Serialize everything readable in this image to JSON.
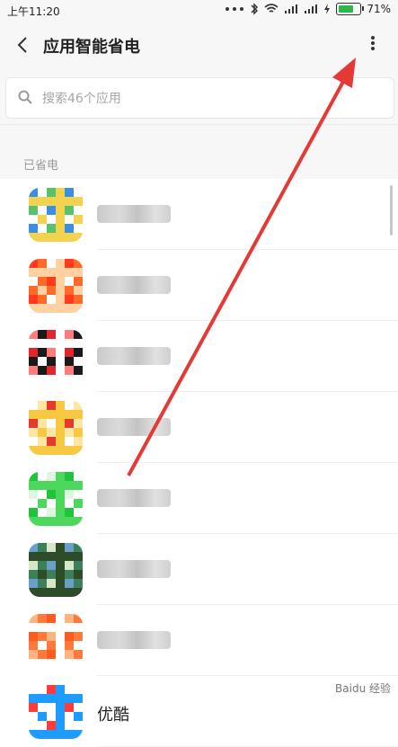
{
  "status": {
    "time": "上午11:20",
    "battery": "71%",
    "battery_level": 0.71
  },
  "appbar": {
    "title": "应用智能省电"
  },
  "search": {
    "placeholder": "搜索46个应用"
  },
  "section": {
    "label": "已省电"
  },
  "apps": [
    {
      "icon_colors": [
        "#3a8fe0",
        "#f2d24e",
        "#58c26a",
        "#ffffff"
      ]
    },
    {
      "icon_colors": [
        "#ff6a2b",
        "#ff3b1b",
        "#ffd0a0",
        "#ffffff"
      ]
    },
    {
      "icon_colors": [
        "#e3262c",
        "#1a1a1a",
        "#ff7c7c",
        "#ffffff"
      ]
    },
    {
      "icon_colors": [
        "#f7c842",
        "#e43a2b",
        "#ffe7a3",
        "#ffffff"
      ]
    },
    {
      "icon_colors": [
        "#1fc43c",
        "#4cd85c",
        "#dff6e1",
        "#ffffff"
      ]
    },
    {
      "icon_colors": [
        "#3c7f5a",
        "#6aa0c8",
        "#2e4c2a",
        "#d8e6c8"
      ]
    },
    {
      "icon_colors": [
        "#ff5a1f",
        "#ff7a3a",
        "#ffb47f",
        "#ffffff"
      ]
    },
    {
      "name": "优酷",
      "icon_colors": [
        "#1e9bff",
        "#ff3b3b",
        "#ffffff",
        "#ffffff"
      ]
    }
  ],
  "watermark": "Baidu 经验",
  "annotation": {
    "arrow_color": "#e53935"
  }
}
